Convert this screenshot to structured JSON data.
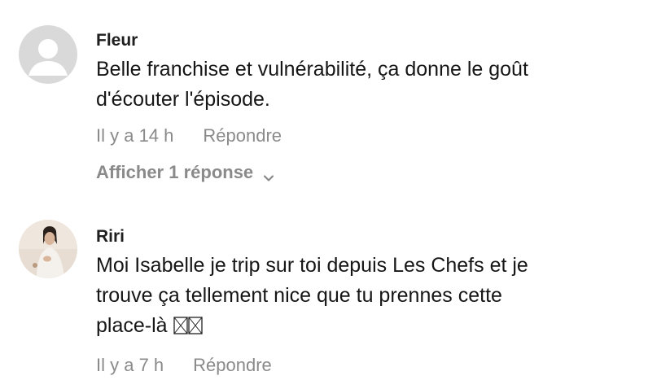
{
  "comments": [
    {
      "author": "Fleur",
      "text_lines": [
        "Belle franchise et vulnérabilité, ça donne le goût",
        "d'écouter l'épisode."
      ],
      "time": "Il y a 14 h",
      "reply_label": "Répondre",
      "show_replies_label": "Afficher 1 réponse",
      "avatar": "default-avatar-icon"
    },
    {
      "author": "Riri",
      "text_lines": [
        "Moi Isabelle je trip sur toi depuis Les Chefs et je",
        "trouve ça tellement nice que tu prennes cette",
        "place-là"
      ],
      "time": "Il y a 7 h",
      "reply_label": "Répondre",
      "avatar": "user-photo"
    }
  ],
  "colors": {
    "text": "#161616",
    "meta": "#8a8a8a",
    "avatar_bg": "#d9d9d9"
  }
}
